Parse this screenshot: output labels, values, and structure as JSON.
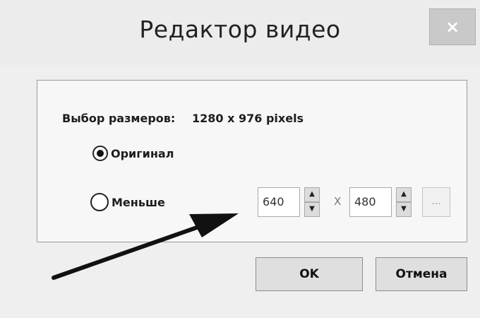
{
  "window": {
    "title": "Редактор видео",
    "close_glyph": "×"
  },
  "dimensions": {
    "label": "Выбор размеров:",
    "value": "1280 x 976 pixels"
  },
  "options": [
    {
      "label": "Оригинал",
      "selected": true
    },
    {
      "label": "Меньше",
      "selected": false
    }
  ],
  "custom_size": {
    "width": "640",
    "separator": "X",
    "height": "480",
    "more_button": "..."
  },
  "buttons": {
    "ok": "OK",
    "cancel": "Отмена"
  },
  "icons": {
    "spin_up": "▲",
    "spin_down": "▼"
  }
}
